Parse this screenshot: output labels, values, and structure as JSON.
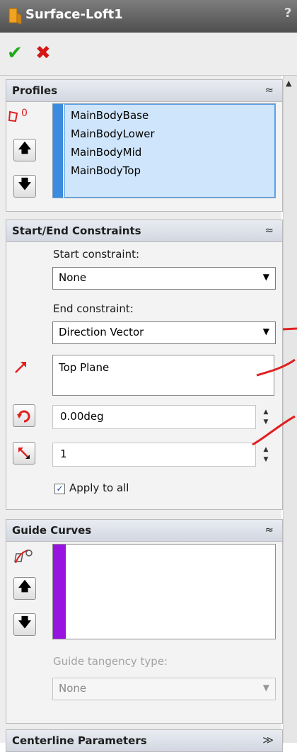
{
  "window": {
    "title": "Surface-Loft1",
    "help": "?"
  },
  "toolbar": {
    "ok_glyph": "✔",
    "cancel_glyph": "✖"
  },
  "profiles": {
    "title": "Profiles",
    "collapse_glyph": "≈",
    "items": [
      "MainBodyBase",
      "MainBodyLower",
      "MainBodyMid",
      "MainBodyTop"
    ],
    "bar_color": "#3b8be0"
  },
  "constraints": {
    "title": "Start/End Constraints",
    "collapse_glyph": "≈",
    "start_label": "Start constraint:",
    "start_value": "None",
    "end_label": "End constraint:",
    "end_value": "Direction Vector",
    "direction_ref": "Top Plane",
    "angle_value": "0.00deg",
    "length_value": "1",
    "apply_all_label": "Apply to all",
    "apply_all_checked": true
  },
  "guide_curves": {
    "title": "Guide Curves",
    "collapse_glyph": "≈",
    "bar_color": "#9812e0",
    "tangency_label": "Guide tangency type:",
    "tangency_value": "None"
  },
  "centerline": {
    "title": "Centerline Parameters",
    "expand_glyph": "≫"
  },
  "icons": {
    "up_arrow": "🡅",
    "down_arrow": "🡇",
    "combo_arrow": "▼",
    "spin_up": "▲",
    "spin_down": "▼"
  },
  "colors": {
    "accent_red": "#e02020",
    "ok_green": "#1faa19"
  }
}
